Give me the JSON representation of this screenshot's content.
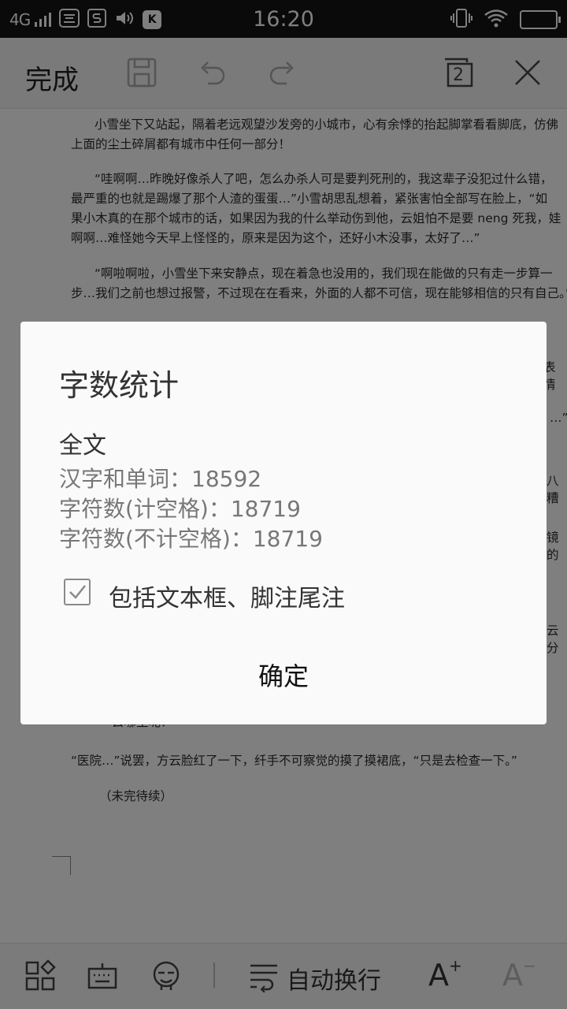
{
  "status_bar": {
    "network": "4G",
    "app_icons": [
      "K"
    ],
    "time": "16:20"
  },
  "toolbar": {
    "done_label": "完成",
    "icons": [
      "save-icon",
      "undo-icon",
      "redo-icon",
      "window-count-icon",
      "close-icon"
    ],
    "window_count": "2"
  },
  "document": {
    "paragraphs": [
      [
        "小雪坐下又站起，隔着老远观望沙发旁的小城市，心有余悸的抬起脚掌看看脚底，仿佛",
        "上面的尘土碎屑都有城市中任何一部分！"
      ],
      [
        "“哇啊啊…昨晚好像杀人了吧，怎么办杀人可是要判死刑的，我这辈子没犯过什么错，",
        "最严重的也就是踢爆了那个人渣的蛋蛋…”小雪胡思乱想着，紧张害怕全部写在脸上，“如",
        "果小木真的在那个城市的话，如果因为我的什么举动伤到他，云姐怕不是要 neng 死我，娃",
        "啊啊…难怪她今天早上怪怪的，原来是因为这个，还好小木没事，太好了…”"
      ],
      [
        "“啊啦啊啦，小雪坐下来安静点，现在着急也没用的，我们现在能做的只有走一步算一",
        "步…我们之前也想过报警，不过现在在看来，外面的人都不可信，现在能够相信的只有自己。”"
      ]
    ],
    "partial_lines": [
      "表情",
      "…”",
      "八糟",
      "镜的",
      "云分",
      "“去哪里呢？"
    ],
    "paragraph_hospital": "“医院…”说罢，方云脸红了一下，纤手不可察觉的摸了摸裙底，“只是去检查一下。”",
    "to_be_continued": "（未完待续）"
  },
  "bottom_bar": {
    "wrap_label": "自动换行",
    "font_increase": "A",
    "font_decrease": "A",
    "icons": [
      "layout-icon",
      "keyboard-icon",
      "reading-mode-icon",
      "wrap-icon",
      "font-increase-icon",
      "font-decrease-icon"
    ]
  },
  "dialog": {
    "title": "字数统计",
    "section": "全文",
    "stats": [
      {
        "label": "汉字和单词：",
        "value": "18592"
      },
      {
        "label": "字符数(计空格)：",
        "value": "18719"
      },
      {
        "label": "字符数(不计空格)：",
        "value": "18719"
      }
    ],
    "checkbox": {
      "label": "包括文本框、脚注尾注",
      "checked": true
    },
    "ok_label": "确定"
  }
}
